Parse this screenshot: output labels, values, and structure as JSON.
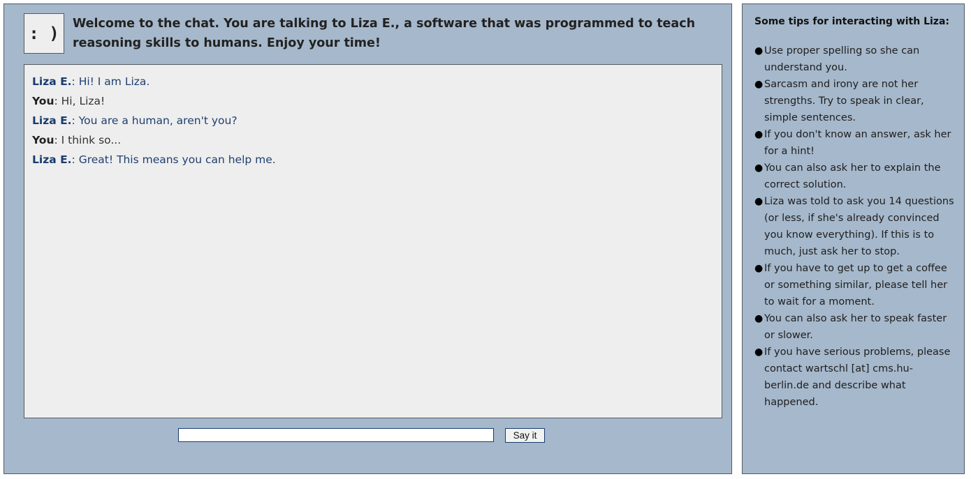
{
  "header": {
    "avatar_text": ": )",
    "welcome_text": "Welcome to the chat. You are talking to Liza E., a software that was programmed to teach reasoning skills to humans. Enjoy your time!"
  },
  "chat": {
    "messages": [
      {
        "speaker": "Liza E.",
        "text": ": Hi! I am Liza."
      },
      {
        "speaker": "You",
        "text": ": Hi, Liza!"
      },
      {
        "speaker": "Liza E.",
        "text": ": You are a human, aren't you?"
      },
      {
        "speaker": "You",
        "text": ": I think so..."
      },
      {
        "speaker": "Liza E.",
        "text": ": Great! This means you can help me."
      }
    ]
  },
  "input": {
    "value": "",
    "placeholder": "",
    "button_label": "Say it"
  },
  "tips": {
    "title": "Some tips for interacting with Liza:",
    "items": [
      "Use proper spelling so she can understand you.",
      "Sarcasm and irony are not her strengths. Try to speak in clear, simple sentences.",
      "If you don't know an answer, ask her for a hint!",
      "You can also ask her to explain the correct solution.",
      "Liza was told to ask you 14 questions (or less, if she's already convinced you know everything). If this is to much, just ask her to stop.",
      "If you have to get up to get a coffee or something similar, please tell her to wait for a moment.",
      "You can also ask her to speak faster or slower.",
      "If you have serious problems, please contact wartschl [at] cms.hu-berlin.de and describe what happened."
    ]
  },
  "colors": {
    "panel_bg": "#a6b8cb",
    "chat_bg": "#eeeeee",
    "liza_text": "#1f3f70",
    "border": "#555a60"
  }
}
